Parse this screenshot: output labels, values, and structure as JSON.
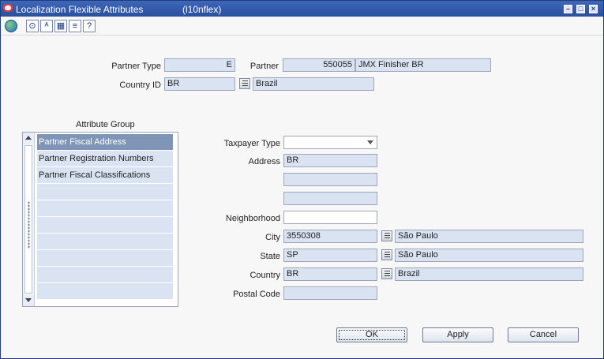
{
  "window": {
    "title": "Localization Flexible Attributes",
    "code": "(l10nflex)",
    "controls": [
      "minimize-icon",
      "maximize-icon",
      "close-icon"
    ]
  },
  "toolbar": {
    "icons": [
      "globe-icon",
      "help-icon",
      "spell-check-icon",
      "calendar-icon",
      "notes-icon",
      "question-icon"
    ],
    "glyphs": [
      "⊙",
      "ᴬ",
      "▦",
      "≡",
      "?"
    ]
  },
  "header": {
    "partner_type_label": "Partner Type",
    "partner_type_value": "E",
    "partner_label": "Partner",
    "partner_id": "550055",
    "partner_name": "JMX Finisher BR",
    "country_id_label": "Country ID",
    "country_id_value": "BR",
    "country_name": "Brazil"
  },
  "attribute_group": {
    "title": "Attribute Group",
    "items": [
      "Partner Fiscal Address",
      "Partner Registration Numbers",
      "Partner Fiscal Classifications",
      "",
      "",
      "",
      "",
      "",
      "",
      ""
    ],
    "selected_index": 0
  },
  "details": {
    "taxpayer_type_label": "Taxpayer Type",
    "taxpayer_type_value": "",
    "address_label": "Address",
    "address_line1": "BR",
    "address_line2": "",
    "address_line3": "",
    "neighborhood_label": "Neighborhood",
    "neighborhood_value": "",
    "city_label": "City",
    "city_code": "3550308",
    "city_name": "São Paulo",
    "state_label": "State",
    "state_code": "SP",
    "state_name": "São Paulo",
    "country_label": "Country",
    "country_code": "BR",
    "country_name": "Brazil",
    "postal_code_label": "Postal Code",
    "postal_code_value": ""
  },
  "buttons": {
    "ok": "OK",
    "apply": "Apply",
    "cancel": "Cancel"
  },
  "colors": {
    "titlebar": "#2a4f9d",
    "field": "#d9e3f1",
    "selected_row": "#7f95b5"
  }
}
